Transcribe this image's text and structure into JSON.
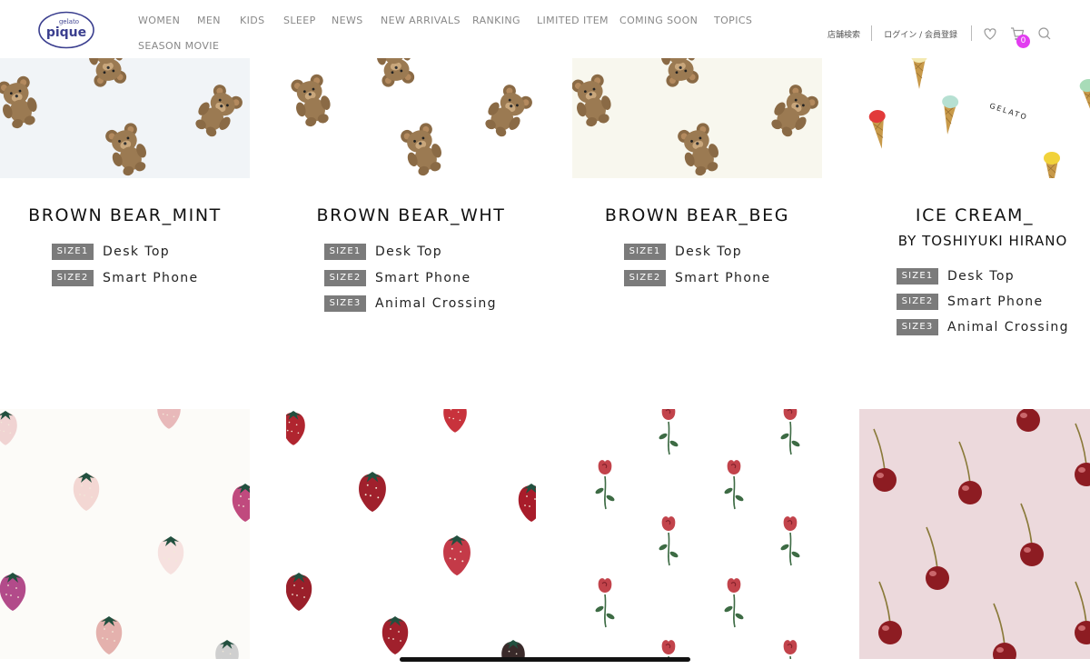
{
  "header": {
    "logo": {
      "small_text": "gelato",
      "main_text": "pique"
    },
    "nav": [
      {
        "label": "WOMEN"
      },
      {
        "label": "MEN"
      },
      {
        "label": "KIDS"
      },
      {
        "label": "SLEEP"
      },
      {
        "label": "NEWS"
      },
      {
        "label": "NEW ARRIVALS"
      },
      {
        "label": "RANKING"
      },
      {
        "label": "LIMITED ITEM"
      },
      {
        "label": "COMING SOON"
      },
      {
        "label": "TOPICS"
      }
    ],
    "nav_row2": "SEASON MOVIE",
    "store_search": "店舗検索",
    "login": "ログイン / 会員登録",
    "cart_count": "0",
    "accent_color": "#e23cf0"
  },
  "wallpapers": [
    {
      "title": "BROWN BEAR_MINT",
      "subtitle": "",
      "bg": "#f1f4f7",
      "sizes": [
        {
          "tag": "SIZE1",
          "label": "Desk Top"
        },
        {
          "tag": "SIZE2",
          "label": "Smart Phone"
        }
      ]
    },
    {
      "title": "BROWN BEAR_WHT",
      "subtitle": "",
      "bg": "#ffffff",
      "sizes": [
        {
          "tag": "SIZE1",
          "label": "Desk Top"
        },
        {
          "tag": "SIZE2",
          "label": "Smart Phone"
        },
        {
          "tag": "SIZE3",
          "label": "Animal Crossing"
        }
      ]
    },
    {
      "title": "BROWN BEAR_BEG",
      "subtitle": "",
      "bg": "#f8f7ee",
      "sizes": [
        {
          "tag": "SIZE1",
          "label": "Desk Top"
        },
        {
          "tag": "SIZE2",
          "label": "Smart Phone"
        }
      ]
    },
    {
      "title": "ICE CREAM_",
      "subtitle": "BY TOSHIYUKI HIRANO",
      "bg": "#ffffff",
      "tile_text": "GELATO",
      "sizes": [
        {
          "tag": "SIZE1",
          "label": "Desk Top"
        },
        {
          "tag": "SIZE2",
          "label": "Smart Phone"
        },
        {
          "tag": "SIZE3",
          "label": "Animal Crossing"
        }
      ]
    }
  ],
  "bottom_tiles": [
    {
      "pattern": "strawberry",
      "bg": "#fcfbf8"
    },
    {
      "pattern": "strawberry",
      "bg": "#ffffff"
    },
    {
      "pattern": "rose",
      "bg": "#ffffff"
    },
    {
      "pattern": "cherry",
      "bg": "#ecd9dc"
    }
  ]
}
